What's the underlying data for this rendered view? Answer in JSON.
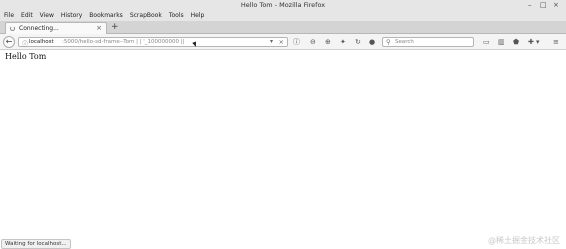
{
  "window": {
    "title": "Hello Tom - Mozilla Firefox"
  },
  "menu": {
    "items": [
      "File",
      "Edit",
      "View",
      "History",
      "Bookmarks",
      "ScrapBook",
      "Tools",
      "Help"
    ]
  },
  "tab": {
    "title": "Connecting..."
  },
  "url": {
    "host": "localhost",
    "rest": ":5000/hello-sd-frame--Tom | | '_100000000 ||",
    "stop_icon": "×"
  },
  "search": {
    "placeholder": "Search"
  },
  "page": {
    "text": "Hello Tom"
  },
  "status": {
    "text": "Waiting for localhost..."
  },
  "watermark": {
    "text": "@稀土掘金技术社区"
  },
  "icons": {
    "back": "back-arrow-icon",
    "info": "info-icon",
    "reload": "reload-icon",
    "search": "search-icon",
    "menu": "hamburger-menu-icon"
  }
}
